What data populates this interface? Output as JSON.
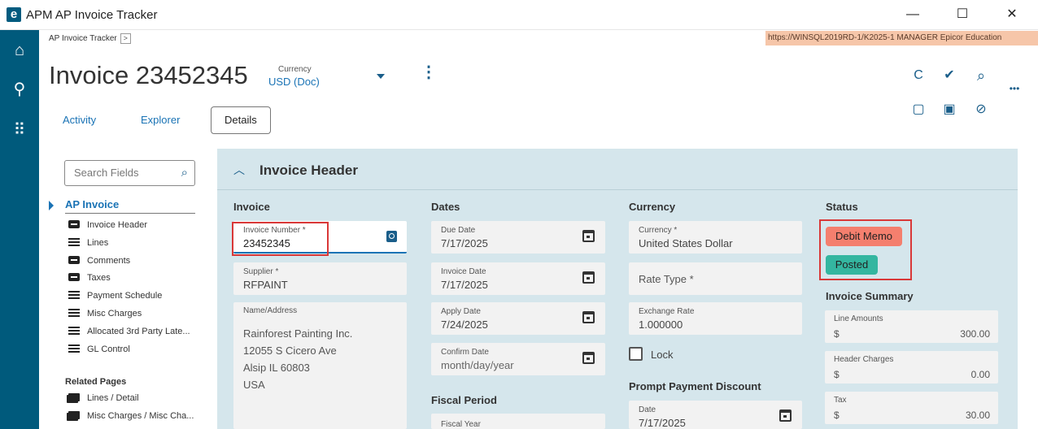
{
  "window": {
    "logo": "e",
    "title": "APM AP Invoice Tracker",
    "minimize": "—",
    "maximize": "☐",
    "close": "✕"
  },
  "breadcrumb": {
    "label": "AP Invoice Tracker",
    "chevron": ">"
  },
  "server_info": "https://WINSQL2019RD-1/K2025-1   MANAGER   Epicor Education",
  "header": {
    "title": "Invoice 23452345",
    "currency_label": "Currency",
    "currency_value": "USD (Doc)"
  },
  "tabs": [
    {
      "label": "Activity"
    },
    {
      "label": "Explorer"
    },
    {
      "label": "Details"
    }
  ],
  "nav": {
    "search_placeholder": "Search Fields",
    "head": "AP Invoice",
    "items": [
      {
        "label": "Invoice Header",
        "icon": "card-icon"
      },
      {
        "label": "Lines",
        "icon": "list-icon"
      },
      {
        "label": "Comments",
        "icon": "card-icon"
      },
      {
        "label": "Taxes",
        "icon": "card-icon"
      },
      {
        "label": "Payment Schedule",
        "icon": "list-icon"
      },
      {
        "label": "Misc Charges",
        "icon": "list-icon"
      },
      {
        "label": "Allocated 3rd Party Late...",
        "icon": "list-icon"
      },
      {
        "label": "GL Control",
        "icon": "list-icon"
      }
    ],
    "related_head": "Related Pages",
    "related": [
      {
        "label": "Lines / Detail",
        "icon": "pages-icon"
      },
      {
        "label": "Misc Charges / Misc Cha...",
        "icon": "pages-icon"
      }
    ]
  },
  "section": {
    "title": "Invoice Header",
    "invoice": {
      "head": "Invoice",
      "invoice_number_label": "Invoice Number *",
      "invoice_number": "23452345",
      "supplier_label": "Supplier *",
      "supplier": "RFPAINT",
      "name_address_label": "Name/Address",
      "address_lines": [
        "Rainforest Painting Inc.",
        "12055 S Cicero Ave",
        "Alsip IL 60803",
        "USA"
      ]
    },
    "dates": {
      "head": "Dates",
      "due_date_label": "Due Date",
      "due_date": "7/17/2025",
      "invoice_date_label": "Invoice Date",
      "invoice_date": "7/17/2025",
      "apply_date_label": "Apply Date",
      "apply_date": "7/24/2025",
      "confirm_date_label": "Confirm Date",
      "confirm_date": "month/day/year",
      "fiscal_period_head": "Fiscal Period",
      "fiscal_year_label": "Fiscal Year"
    },
    "currency": {
      "head": "Currency",
      "currency_label": "Currency *",
      "currency_value": "United States Dollar",
      "rate_type_label": "Rate Type *",
      "exchange_rate_label": "Exchange Rate",
      "exchange_rate": "1.000000",
      "lock_label": "Lock",
      "prompt_head": "Prompt Payment Discount",
      "date_label": "Date",
      "date_value": "7/17/2025"
    },
    "status": {
      "head": "Status",
      "debit_memo": "Debit Memo",
      "posted": "Posted",
      "summary_head": "Invoice Summary",
      "debit_color": "#f47f6e",
      "posted_color": "#34b6a0",
      "summary": [
        {
          "label": "Line Amounts",
          "currency": "$",
          "amount": "300.00"
        },
        {
          "label": "Header Charges",
          "currency": "$",
          "amount": "0.00"
        },
        {
          "label": "Tax",
          "currency": "$",
          "amount": "30.00"
        }
      ]
    }
  },
  "icons": {
    "refresh": "C",
    "clear": "✔",
    "search": "⌕",
    "more": "•••",
    "new": "▢",
    "panel": "▣",
    "attach": "⊘",
    "home": "⌂",
    "rail_search": "⚲",
    "apps": "⠿",
    "kebab": "⋮"
  }
}
